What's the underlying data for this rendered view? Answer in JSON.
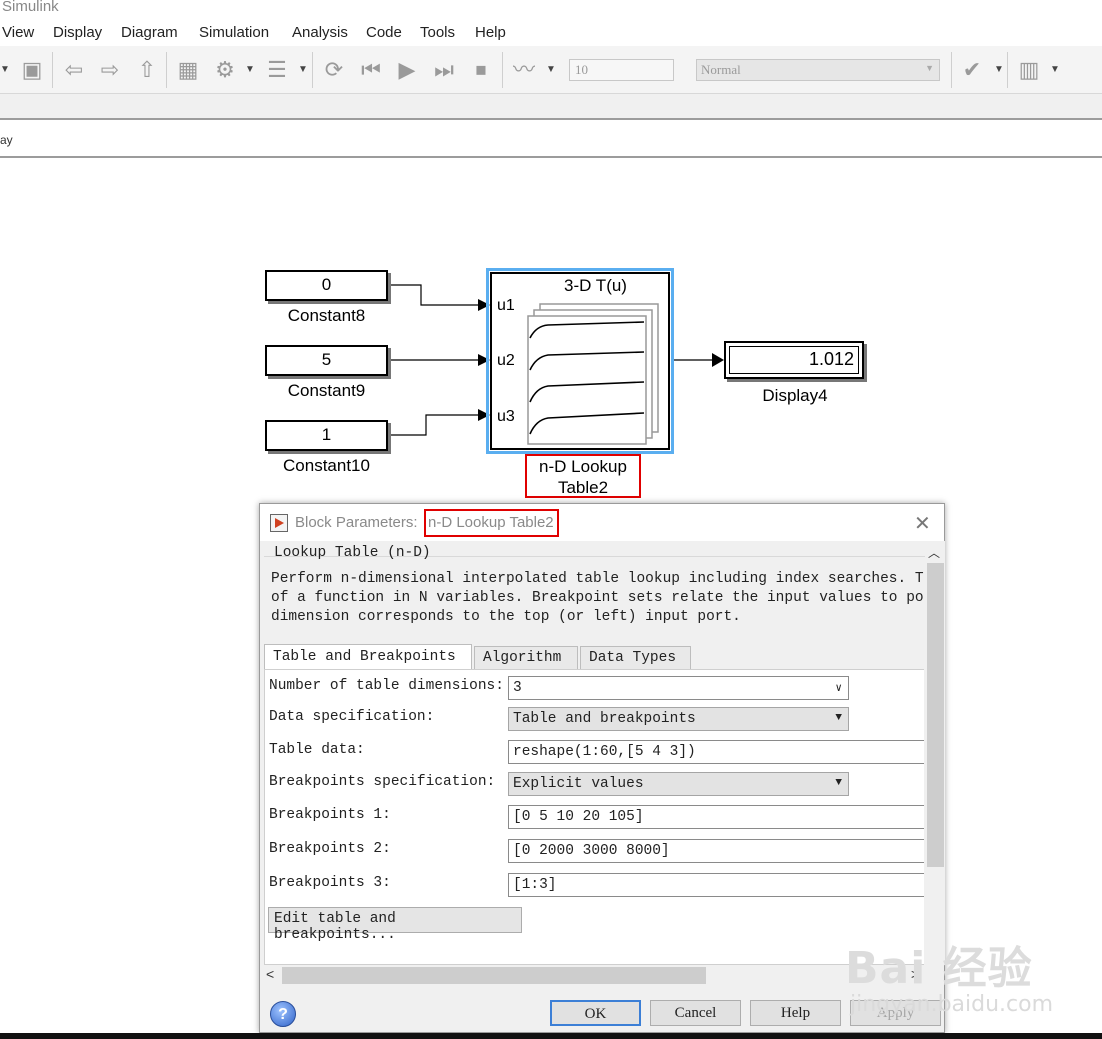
{
  "window": {
    "title": "Simulink"
  },
  "menu": [
    "View",
    "Display",
    "Diagram",
    "Simulation",
    "Analysis",
    "Code",
    "Tools",
    "Help"
  ],
  "toolbar": {
    "stop_time": "10",
    "sim_mode": "Normal"
  },
  "address": {
    "path": "ay"
  },
  "diagram": {
    "constants": [
      {
        "value": "0",
        "name": "Constant8"
      },
      {
        "value": "5",
        "name": "Constant9"
      },
      {
        "value": "1",
        "name": "Constant10"
      }
    ],
    "lookup": {
      "header": "3-D T(u)",
      "ports": [
        "u1",
        "u2",
        "u3"
      ],
      "name_line1": "n-D Lookup",
      "name_line2": "Table2"
    },
    "display": {
      "value": "1.012",
      "name": "Display4"
    }
  },
  "dialog": {
    "title_prefix": "Block Parameters: ",
    "block_name": "n-D Lookup Table2",
    "close": "✕",
    "group_title": "Lookup Table (n-D)",
    "description": "Perform n-dimensional interpolated table lookup including index searches. The\nof a function in N variables. Breakpoint sets relate the input values to posi\ndimension corresponds to the top (or left) input port.",
    "tabs": [
      "Table and Breakpoints",
      "Algorithm",
      "Data Types"
    ],
    "params": {
      "num_dims": {
        "label": "Number of table dimensions:",
        "value": "3"
      },
      "data_spec": {
        "label": "Data specification:",
        "value": "Table and breakpoints"
      },
      "table_data": {
        "label": "Table data:",
        "value": "reshape(1:60,[5 4 3])"
      },
      "bp_spec": {
        "label": "Breakpoints specification:",
        "value": "Explicit values"
      },
      "bp1": {
        "label": "Breakpoints 1:",
        "value": "[0 5 10 20 105]"
      },
      "bp2": {
        "label": "Breakpoints 2:",
        "value": "[0 2000 3000 8000]"
      },
      "bp3": {
        "label": "Breakpoints 3:",
        "value": "[1:3]"
      }
    },
    "edit_button": "Edit table and breakpoints...",
    "buttons": {
      "ok": "OK",
      "cancel": "Cancel",
      "help": "Help",
      "apply": "Apply"
    }
  },
  "watermark": {
    "brand": "Bai  经验",
    "url": "jingyan.baidu.com"
  }
}
